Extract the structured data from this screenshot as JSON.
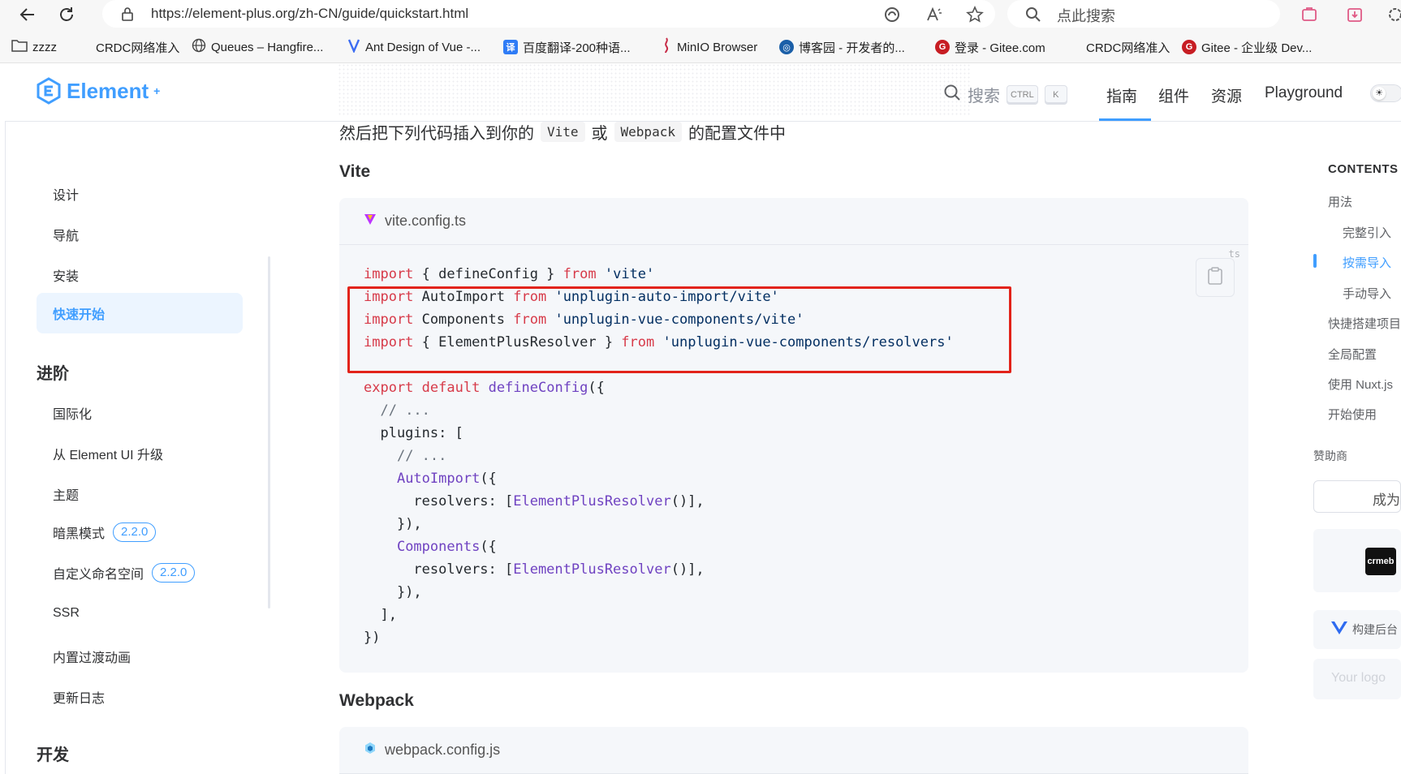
{
  "browser": {
    "url": "https://element-plus.org/zh-CN/guide/quickstart.html",
    "search_placeholder": "点此搜索"
  },
  "bookmarks": [
    "zzzz",
    "CRDC网络准入",
    "Queues – Hangfire...",
    "Ant Design of Vue -...",
    "百度翻译-200种语...",
    "MinIO Browser",
    "博客园 - 开发者的...",
    "登录 - Gitee.com",
    "CRDC网络准入",
    "Gitee - 企业级 Dev..."
  ],
  "header": {
    "logo_text": "Element",
    "search_label": "搜索",
    "kbd_ctrl": "CTRL",
    "kbd_k": "K",
    "nav": [
      "指南",
      "组件",
      "资源",
      "Playground"
    ],
    "active_nav": "指南"
  },
  "sidebar": {
    "items_top": [
      "设计",
      "导航",
      "安装",
      "快速开始"
    ],
    "active_item": "快速开始",
    "group_advanced": "进阶",
    "items_advanced": [
      "国际化",
      "从 Element UI 升级",
      "主题",
      "暗黑模式",
      "自定义命名空间",
      "SSR",
      "内置过渡动画",
      "更新日志"
    ],
    "badge_dark": "2.2.0",
    "badge_namespace": "2.2.0",
    "group_dev": "开发"
  },
  "content": {
    "intro_before": "然后把下列代码插入到你的",
    "intro_vite": "Vite",
    "intro_or": "或",
    "intro_webpack": "Webpack",
    "intro_after": "的配置文件中",
    "vite_heading": "Vite",
    "vite_filename": "vite.config.ts",
    "lang_label": "ts",
    "webpack_heading": "Webpack",
    "webpack_filename": "webpack.config.js"
  },
  "toc": {
    "title": "CONTENTS",
    "items": [
      "用法",
      "完整引入",
      "按需导入",
      "手动导入",
      "快捷搭建项目",
      "全局配置",
      "使用 Nuxt.js",
      "开始使用"
    ],
    "active": "按需导入",
    "sponsor_label": "赞助商",
    "sponsor_cta": "成为",
    "sponsor_vue_text": "构建后台",
    "sponsor_placeholder": "Your logo"
  },
  "colors": {
    "accent": "#409eff",
    "highlight": "#e2231a"
  }
}
